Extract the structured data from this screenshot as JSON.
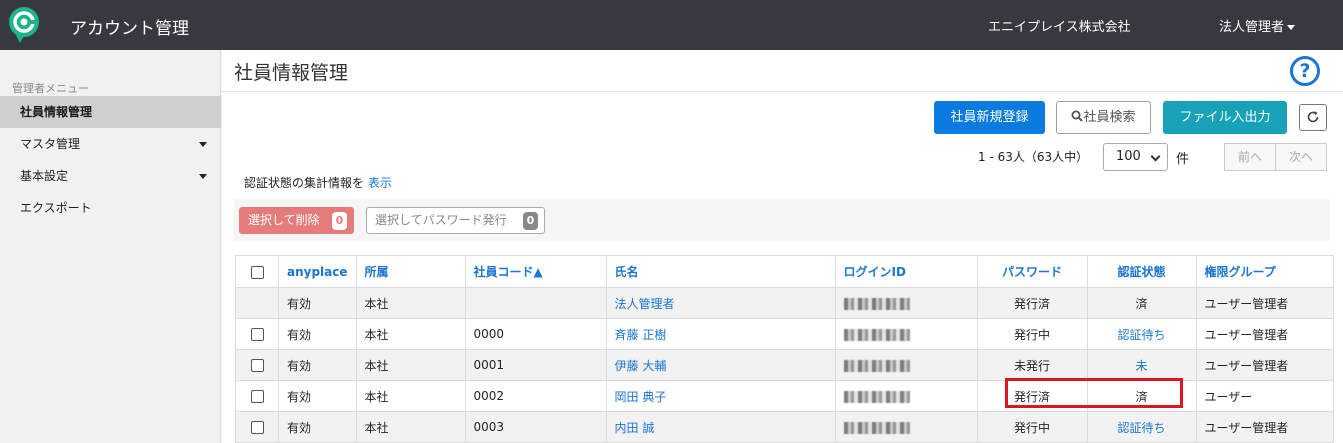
{
  "header": {
    "title": "アカウント管理",
    "company": "エニイプレイス株式会社",
    "user_menu": "法人管理者",
    "brand_color": "#1fb389"
  },
  "sidebar": {
    "heading": "管理者メニュー",
    "items": [
      {
        "label": "社員情報管理",
        "active": true,
        "has_caret": false
      },
      {
        "label": "マスタ管理",
        "active": false,
        "has_caret": true
      },
      {
        "label": "基本設定",
        "active": false,
        "has_caret": true
      },
      {
        "label": "エクスポート",
        "active": false,
        "has_caret": false
      }
    ]
  },
  "main": {
    "page_title": "社員情報管理",
    "help_label": "?",
    "toolbar": {
      "new_label": "社員新規登録",
      "search_label": "社員検索",
      "file_label": "ファイル入出力",
      "refresh_icon": "refresh-icon"
    },
    "pager": {
      "info": "1 - 63人（63人中）",
      "per_page": "100",
      "unit": "件",
      "prev": "前へ",
      "next": "次へ"
    },
    "auth_summary": {
      "text": "認証状態の集計情報を ",
      "link": "表示"
    },
    "bulk": {
      "delete_label": "選択して削除",
      "delete_count": "0",
      "password_label": "選択してパスワード発行",
      "password_count": "0"
    },
    "table": {
      "headers": [
        "anyplace",
        "所属",
        "社員コード▲",
        "氏名",
        "ログインID",
        "パスワード",
        "認証状態",
        "権限グループ"
      ],
      "rows": [
        {
          "checkbox": false,
          "anyplace": "有効",
          "dept": "本社",
          "code": "",
          "name": "法人管理者",
          "password": "発行済",
          "auth": "済",
          "auth_link": false,
          "group": "ユーザー管理者",
          "shaded": true
        },
        {
          "checkbox": true,
          "anyplace": "有効",
          "dept": "本社",
          "code": "0000",
          "name": "斉藤 正樹",
          "password": "発行中",
          "auth": "認証待ち",
          "auth_link": true,
          "group": "ユーザー管理者",
          "shaded": false
        },
        {
          "checkbox": true,
          "anyplace": "有効",
          "dept": "本社",
          "code": "0001",
          "name": "伊藤 大輔",
          "password": "未発行",
          "auth": "未",
          "auth_link": true,
          "group": "ユーザー管理者",
          "shaded": true
        },
        {
          "checkbox": true,
          "anyplace": "有効",
          "dept": "本社",
          "code": "0002",
          "name": "岡田 典子",
          "password": "発行済",
          "auth": "済",
          "auth_link": false,
          "group": "ユーザー",
          "shaded": false
        },
        {
          "checkbox": true,
          "anyplace": "有効",
          "dept": "本社",
          "code": "0003",
          "name": "内田 誠",
          "password": "発行中",
          "auth": "認証待ち",
          "auth_link": true,
          "group": "ユーザー管理者",
          "shaded": true
        }
      ]
    }
  }
}
